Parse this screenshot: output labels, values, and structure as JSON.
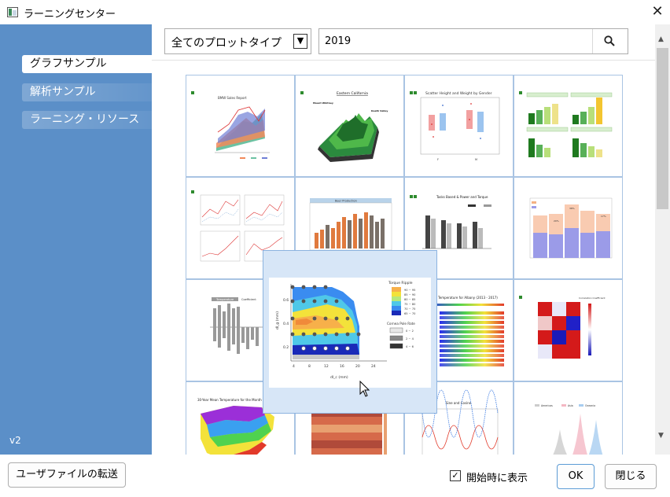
{
  "window": {
    "title": "ラーニングセンター"
  },
  "sidebar": {
    "items": [
      {
        "label": "グラフサンプル",
        "active": true
      },
      {
        "label": "解析サンプル",
        "active": false
      },
      {
        "label": "ラーニング・リソース",
        "active": false
      }
    ],
    "version": "v2"
  },
  "filter": {
    "selected": "全てのプロットタイプ"
  },
  "search": {
    "value": "2019"
  },
  "thumbnails": {
    "t1": {
      "title": "BMW Sales Report"
    },
    "t2": {
      "title": "Eastern California",
      "label_a": "Mount Whitney",
      "label_b": "Death Valley"
    },
    "t3": {
      "title": "Scatter Height and Weight by Gender",
      "x_a": "F",
      "x_b": "M"
    },
    "t6": {
      "title": "Beer Production"
    },
    "t7": {
      "title": "Tasks Based & Power and Torque"
    },
    "t8": {
      "label_a": "20%",
      "label_b": "38%",
      "label_c": "17%"
    },
    "t9": {
      "legend_a": "Temperature",
      "legend_b": "Coefficient"
    },
    "t10": {
      "title": "Temperature for Albany (2013 - 2017)"
    },
    "t11": {
      "title": "Correlation Coefficient"
    },
    "t13": {
      "title": "30-Year Mean Temperature for the Month"
    },
    "t15": {
      "title": "Sine and Cosine"
    },
    "t16": {
      "legend_a": "Americas",
      "legend_b": "Asia",
      "legend_c": "Oceania"
    }
  },
  "preview": {
    "legend_title": "Torque Ripple",
    "legend_levels": [
      "90 ~ 95",
      "85 ~ 90",
      "80 ~ 85",
      "75 ~ 80",
      "70 ~ 75",
      "65 ~ 70"
    ],
    "legend2_title": "Cornea Pole Rate",
    "legend2_levels": [
      "0 ~ 2",
      "2 ~ 4",
      "4 ~ 6"
    ],
    "ylabel": "dI_g (mm)",
    "xlabel": "dI_c (mm)",
    "xticks": [
      "4",
      "8",
      "12",
      "16",
      "20",
      "24"
    ],
    "yticks": [
      "0.2",
      "0.4",
      "0.6"
    ]
  },
  "footer": {
    "transfer_label": "ユーザファイルの転送",
    "show_at_startup_label": "開始時に表示",
    "show_at_startup_checked": "✓",
    "ok_label": "OK",
    "close_label": "閉じる"
  }
}
